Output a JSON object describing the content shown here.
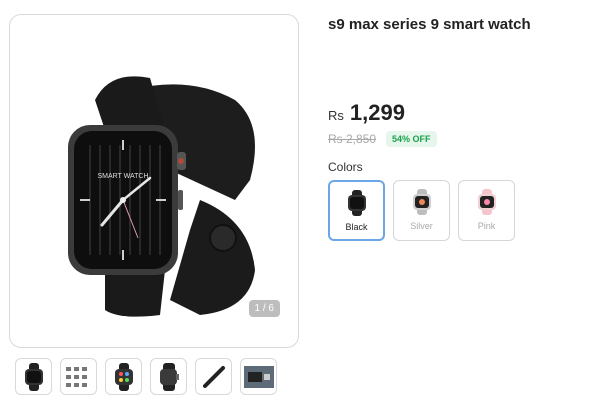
{
  "product": {
    "title": "s9 max series 9 smart watch",
    "currency": "Rs",
    "price": "1,299",
    "old_price": "Rs 2,850",
    "discount": "54% OFF"
  },
  "gallery": {
    "counter": "1 / 6",
    "watch_face_text": "SMART WATCH",
    "thumbnails": [
      "black-watch-thumb",
      "features-grid-thumb",
      "colorful-face-thumb",
      "black-watch-side-thumb",
      "strap-thumb",
      "packaging-thumb"
    ]
  },
  "colors": {
    "label": "Colors",
    "options": [
      {
        "label": "Black",
        "selected": true
      },
      {
        "label": "Silver",
        "selected": false
      },
      {
        "label": "Pink",
        "selected": false
      }
    ]
  }
}
